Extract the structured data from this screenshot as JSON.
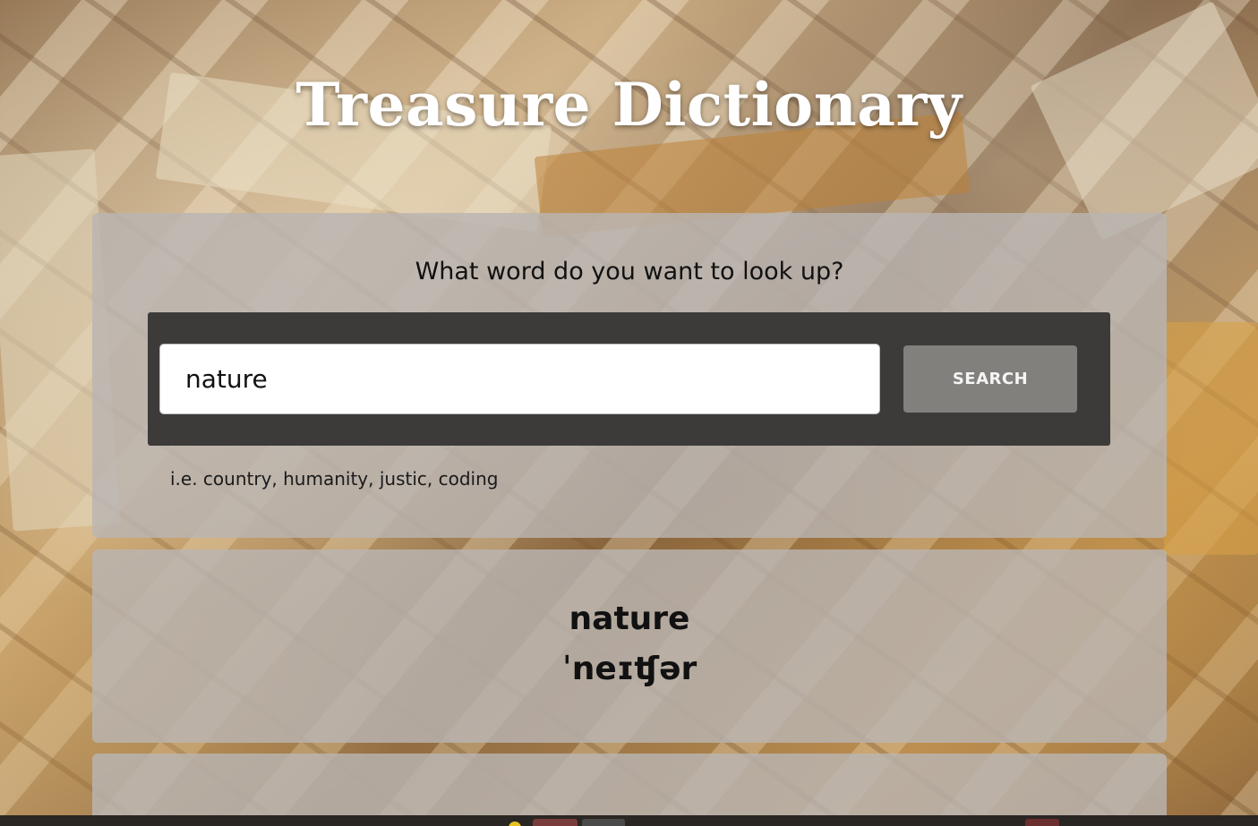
{
  "app": {
    "title": "Treasure Dictionary"
  },
  "search": {
    "prompt": "What word do you want to look up?",
    "value": "nature",
    "button_label": "SEARCH",
    "hint": "i.e. country, humanity, justic, coding"
  },
  "result": {
    "word": "nature",
    "phonetic": "ˈneɪʧər"
  },
  "colors": {
    "search_bar": "#3d3b39",
    "button": "#82807c",
    "card": "#b9b4b2",
    "title": "#ffffff"
  }
}
